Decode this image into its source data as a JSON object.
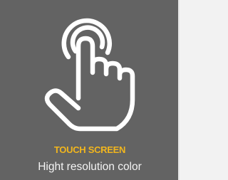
{
  "feature": {
    "icon": "touch-hand-icon",
    "title": "TOUCH SCREEN",
    "subtitle": "Hight resolution color",
    "colors": {
      "background": "#636363",
      "title": "#f2b61d",
      "subtitle": "#f4f4f4",
      "icon_stroke": "#ffffff"
    }
  }
}
